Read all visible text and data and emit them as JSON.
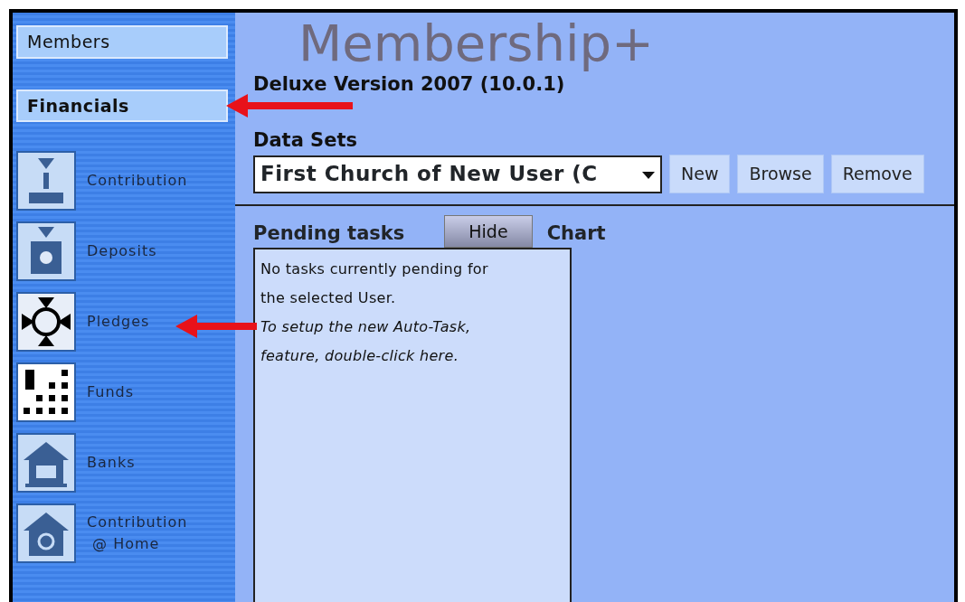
{
  "sections": [
    {
      "label": "Members",
      "selected": false
    },
    {
      "label": "Financials",
      "selected": true
    }
  ],
  "nav_items": [
    {
      "label": "Contribution"
    },
    {
      "label": "Deposits"
    },
    {
      "label": "Pledges"
    },
    {
      "label": "Funds"
    },
    {
      "label": "Banks"
    },
    {
      "label": "Contribution\n @ Home"
    }
  ],
  "logo_text": "Membership+",
  "version": "Deluxe Version 2007 (10.0.1)",
  "data_sets": {
    "label": "Data Sets",
    "value": "First Church of New User (C",
    "buttons": [
      "New",
      "Browse",
      "Remove"
    ]
  },
  "pending_tasks": {
    "title": "Pending tasks",
    "hide_button": "Hide",
    "message": "No tasks currently pending for the selected User.",
    "hint": "To setup the new Auto-Task, feature, double-click here."
  },
  "chart": {
    "title": "Chart"
  }
}
